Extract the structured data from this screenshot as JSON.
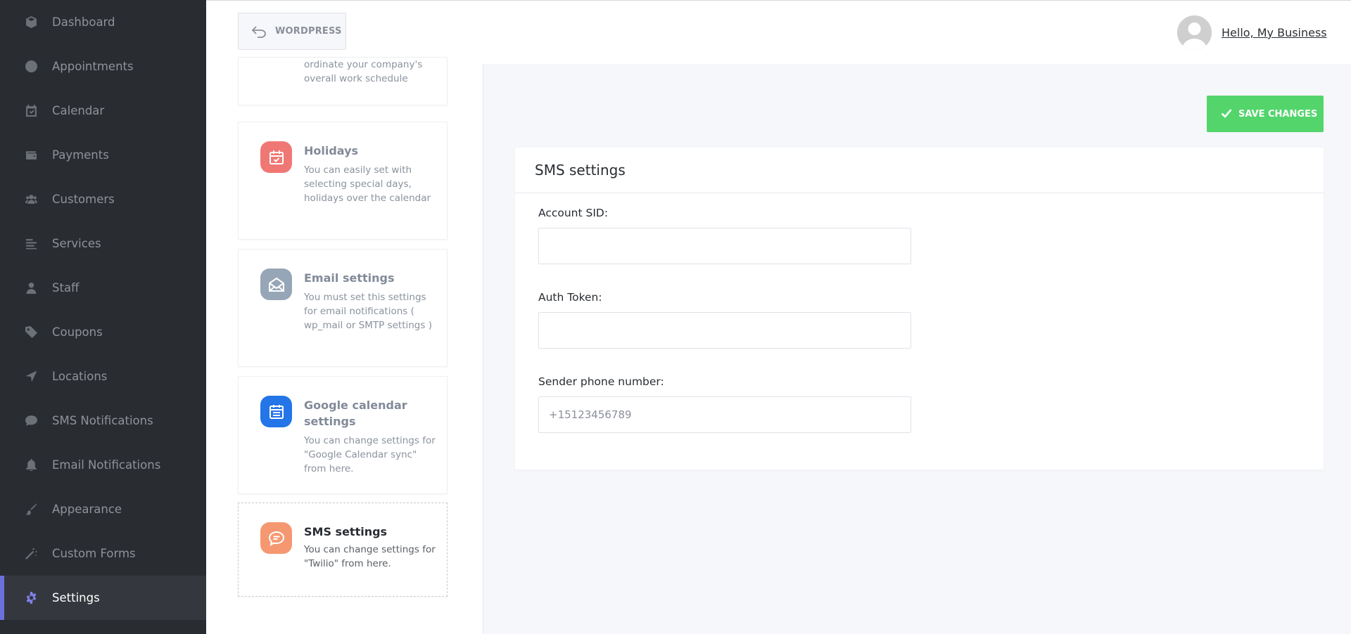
{
  "sidebar": {
    "items": [
      {
        "label": "Dashboard",
        "icon": "cube-icon"
      },
      {
        "label": "Appointments",
        "icon": "clock-icon"
      },
      {
        "label": "Calendar",
        "icon": "calendar-check-icon"
      },
      {
        "label": "Payments",
        "icon": "wallet-icon"
      },
      {
        "label": "Customers",
        "icon": "users-icon"
      },
      {
        "label": "Services",
        "icon": "list-icon"
      },
      {
        "label": "Staff",
        "icon": "user-icon"
      },
      {
        "label": "Coupons",
        "icon": "tag-icon"
      },
      {
        "label": "Locations",
        "icon": "location-arrow-icon"
      },
      {
        "label": "SMS Notifications",
        "icon": "comment-icon"
      },
      {
        "label": "Email Notifications",
        "icon": "bell-icon"
      },
      {
        "label": "Appearance",
        "icon": "brush-icon"
      },
      {
        "label": "Custom Forms",
        "icon": "magic-icon"
      },
      {
        "label": "Settings",
        "icon": "gear-icon",
        "active": true
      }
    ],
    "accent_color": "#6c70dc"
  },
  "header": {
    "back_label": "WORDPRESS",
    "greeting": "Hello, My Business"
  },
  "settings_cards": [
    {
      "title": "",
      "desc": "ordinate your company's overall work schedule",
      "partial": true
    },
    {
      "title": "Holidays",
      "desc": "You can easily set with selecting special days, holidays over the calendar",
      "icon": "calendar-check-icon",
      "color": "#f07874"
    },
    {
      "title": "Email settings",
      "desc": "You must set this settings for email notifications ( wp_mail or SMTP settings )",
      "icon": "envelope-open-icon",
      "color": "#96a6b6"
    },
    {
      "title": "Google calendar settings",
      "desc": "You can change settings for \"Google Calendar sync\" from here.",
      "icon": "calendar-list-icon",
      "color": "#2475e8"
    },
    {
      "title": "SMS settings",
      "desc": "You can change settings for \"Twilio\" from here.",
      "icon": "chat-bubble-icon",
      "color": "#f59872",
      "active": true
    }
  ],
  "main": {
    "save_label": "SAVE CHANGES",
    "save_color": "#53d56c",
    "panel_title": "SMS settings",
    "fields": {
      "account_sid": {
        "label": "Account SID:",
        "value": "",
        "placeholder": ""
      },
      "auth_token": {
        "label": "Auth Token:",
        "value": "",
        "placeholder": ""
      },
      "sender_phone": {
        "label": "Sender phone number:",
        "value": "",
        "placeholder": "+15123456789"
      }
    }
  }
}
